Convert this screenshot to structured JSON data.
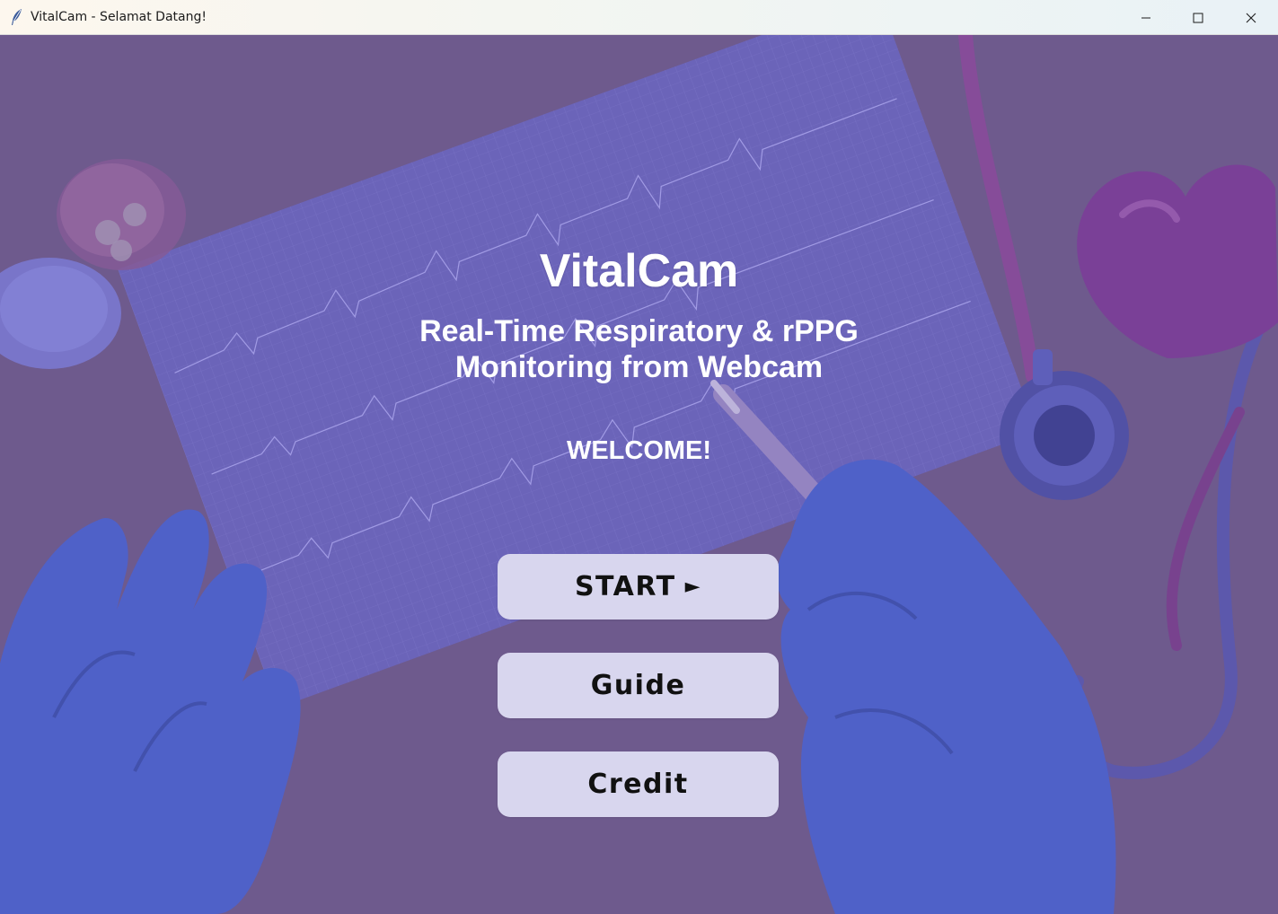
{
  "window": {
    "title": "VitalCam - Selamat Datang!"
  },
  "icons": {
    "app": "feather-icon",
    "minimize": "minimize-icon",
    "maximize": "maximize-icon",
    "close": "close-icon",
    "start": "play-icon"
  },
  "main": {
    "app_name": "VitalCam",
    "subtitle_line1": "Real-Time Respiratory & rPPG",
    "subtitle_line2": "Monitoring from Webcam",
    "welcome": "WELCOME!"
  },
  "buttons": {
    "start": "START",
    "start_icon": "►",
    "guide": "Guide",
    "credit": "Credit"
  },
  "colors": {
    "overlay": "#6f5a8c",
    "button_bg": "#d8d6ee",
    "text": "#ffffff"
  }
}
